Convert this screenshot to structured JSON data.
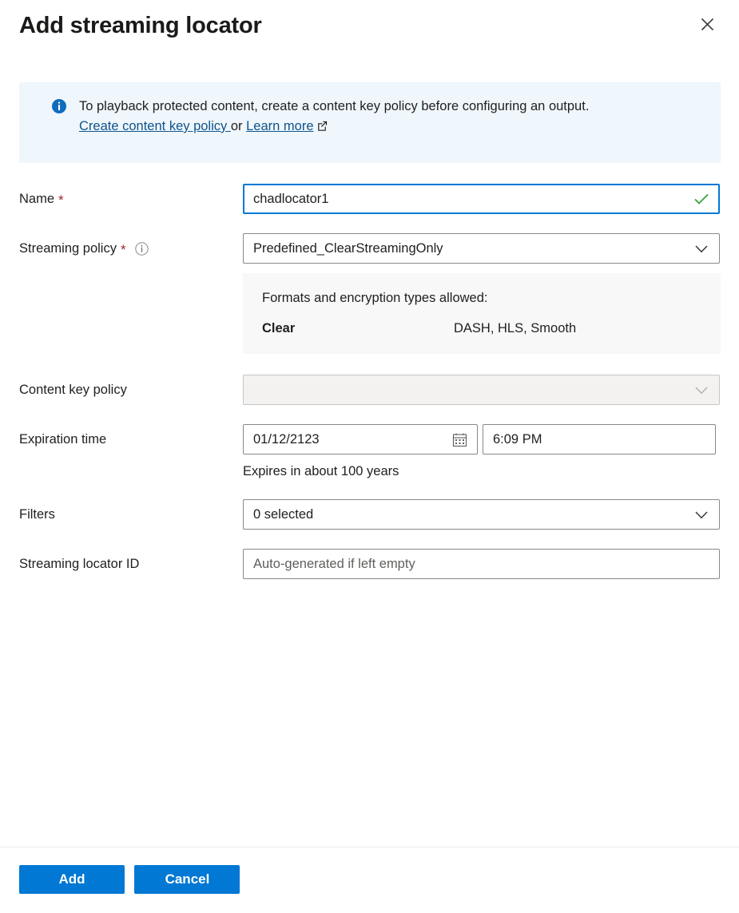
{
  "header": {
    "title": "Add streaming locator",
    "close_label": "Close"
  },
  "banner": {
    "icon": "info-icon",
    "message": "To playback protected content, create a content key policy before configuring an output.",
    "link_primary": "Create content key policy ",
    "conjunction": "or ",
    "link_secondary": "Learn more",
    "external_icon": "external-link-icon",
    "background": "#eff6fc",
    "link_color": "#0f548c"
  },
  "form": {
    "name": {
      "label": "Name",
      "required_marker": "*",
      "value": "chadlocator1",
      "valid_icon": "checkmark-icon",
      "valid_color": "#107c10",
      "focus_color": "#0078d4"
    },
    "streaming_policy": {
      "label": "Streaming policy",
      "required_marker": "*",
      "info_icon": "info-circle-icon",
      "value": "Predefined_ClearStreamingOnly",
      "chevron_icon": "chevron-down-icon"
    },
    "formats_panel": {
      "title": "Formats and encryption types allowed:",
      "rows": [
        {
          "name": "Clear",
          "formats": "DASH, HLS, Smooth"
        }
      ]
    },
    "content_key_policy": {
      "label": "Content key policy",
      "value": "",
      "disabled": true,
      "chevron_icon": "chevron-down-icon"
    },
    "expiration_time": {
      "label": "Expiration time",
      "date_value": "01/12/2123",
      "calendar_icon": "calendar-icon",
      "time_value": "6:09 PM",
      "helper_text": "Expires in about 100 years"
    },
    "filters": {
      "label": "Filters",
      "value": "0 selected",
      "chevron_icon": "chevron-down-icon"
    },
    "streaming_locator_id": {
      "label": "Streaming locator ID",
      "value": "",
      "placeholder": "Auto-generated if left empty"
    }
  },
  "footer": {
    "add_label": "Add",
    "cancel_label": "Cancel",
    "button_color": "#0078d4"
  }
}
